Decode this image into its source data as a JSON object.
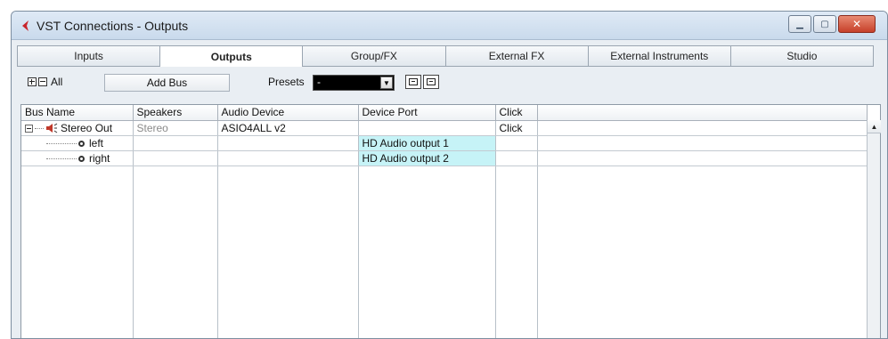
{
  "window": {
    "title": "VST Connections - Outputs",
    "minimize_icon": "minimize-icon",
    "maximize_icon": "maximize-icon",
    "close_icon": "close-icon",
    "accent": "#c6402a"
  },
  "tabs": [
    {
      "label": "Inputs",
      "active": false
    },
    {
      "label": "Outputs",
      "active": true
    },
    {
      "label": "Group/FX",
      "active": false
    },
    {
      "label": "External FX",
      "active": false
    },
    {
      "label": "External Instruments",
      "active": false
    },
    {
      "label": "Studio",
      "active": false
    }
  ],
  "toolbar": {
    "all_label": "All",
    "add_bus_label": "Add Bus",
    "presets_label": "Presets",
    "presets_value": "-"
  },
  "grid": {
    "columns": [
      "Bus Name",
      "Speakers",
      "Audio Device",
      "Device Port",
      "Click"
    ],
    "rows": [
      {
        "bus_name": "Stereo Out",
        "speakers": "Stereo",
        "audio_device": "ASIO4ALL v2",
        "device_port": "",
        "click": "Click"
      },
      {
        "bus_name": "left",
        "speakers": "",
        "audio_device": "",
        "device_port": "HD Audio output 1",
        "click": ""
      },
      {
        "bus_name": "right",
        "speakers": "",
        "audio_device": "",
        "device_port": "HD Audio output 2",
        "click": ""
      }
    ],
    "port_highlight_color": "#c6f3f7"
  }
}
